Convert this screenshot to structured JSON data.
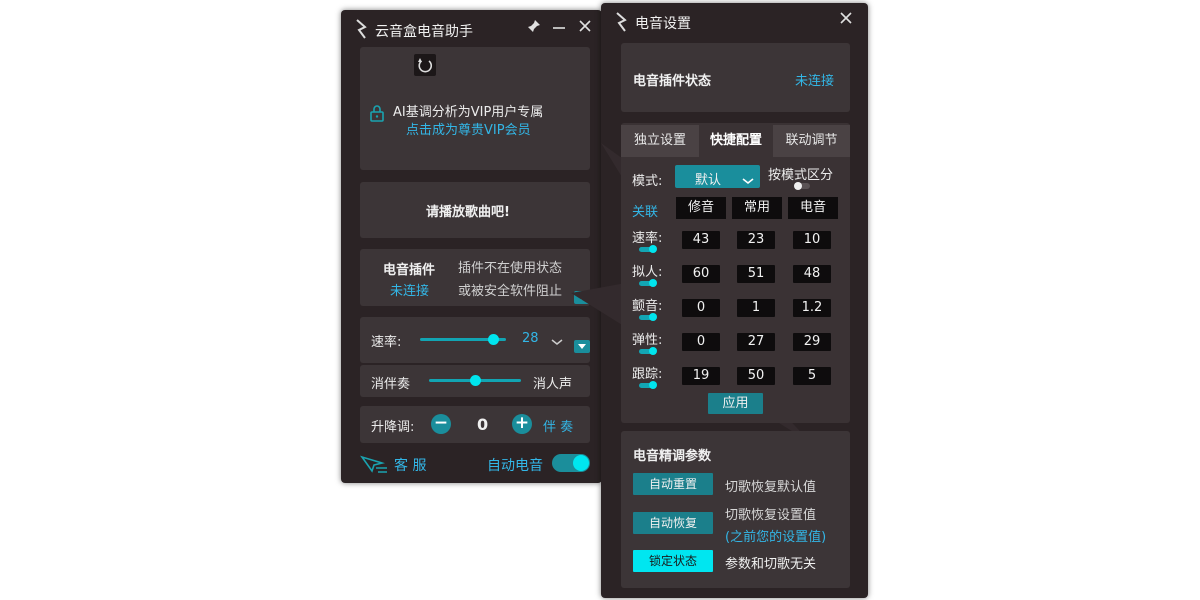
{
  "left": {
    "title": "云音盒电音助手",
    "vip": {
      "line1": "AI基调分析为VIP用户专属",
      "line2": "点击成为尊贵VIP会员"
    },
    "play_prompt": "请播放歌曲吧!",
    "plugin": {
      "label": "电音插件",
      "status": "未连接",
      "note1": "插件不在使用状态",
      "note2": "或被安全软件阻止"
    },
    "rate": {
      "label": "速率:",
      "value": "28",
      "level": 0.85
    },
    "accomp": {
      "left": "消伴奏",
      "right": "消人声",
      "level": 0.5
    },
    "pitch": {
      "label": "升降调:",
      "minus": "−",
      "value": "0",
      "plus": "+",
      "mode": "伴 奏"
    },
    "service": "客 服",
    "auto": {
      "label": "自动电音",
      "on": true
    }
  },
  "right": {
    "title": "电音设置",
    "status": {
      "label": "电音插件状态",
      "value": "未连接"
    },
    "tabs": [
      "独立设置",
      "快捷配置",
      "联动调节"
    ],
    "active_tab": 1,
    "mode": {
      "label": "模式:",
      "value": "默认",
      "right_label": "按模式区分"
    },
    "link_label": "关联",
    "headers": [
      "修音",
      "常用",
      "电音"
    ],
    "rows": [
      {
        "label": "速率:",
        "values": [
          "43",
          "23",
          "10"
        ]
      },
      {
        "label": "拟人:",
        "values": [
          "60",
          "51",
          "48"
        ]
      },
      {
        "label": "颤音:",
        "values": [
          "0",
          "1",
          "1.2"
        ]
      },
      {
        "label": "弹性:",
        "values": [
          "0",
          "27",
          "29"
        ]
      },
      {
        "label": "跟踪:",
        "values": [
          "19",
          "50",
          "5"
        ]
      }
    ],
    "apply": "应用",
    "fine": {
      "title": "电音精调参数",
      "reset_btn": "自动重置",
      "reset_desc": "切歌恢复默认值",
      "restore_btn": "自动恢复",
      "restore_desc": "切歌恢复设置值",
      "restore_note": "(之前您的设置值)",
      "lock_btn": "锁定状态",
      "lock_desc": "参数和切歌无关"
    }
  }
}
